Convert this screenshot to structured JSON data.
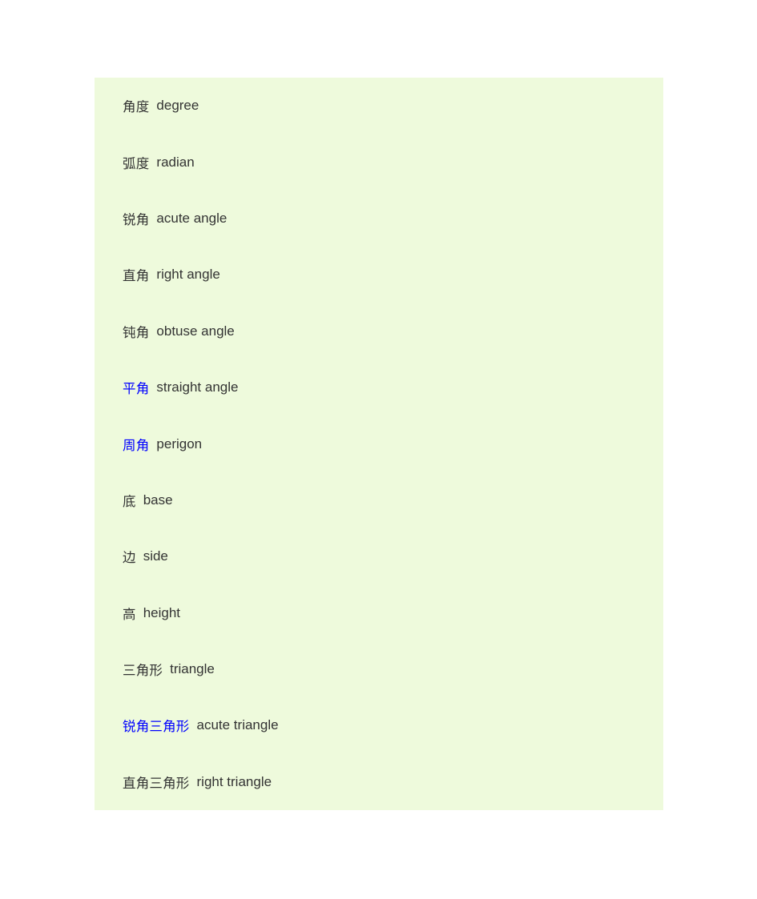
{
  "page": {
    "background_color": "#ffffff",
    "panel_background_color": "#eefadc",
    "text_color": "#333333",
    "link_color": "#0000ff"
  },
  "glossary": {
    "entries": [
      {
        "cn": "角度",
        "en": "degree",
        "is_link": false
      },
      {
        "cn": "弧度",
        "en": "radian",
        "is_link": false
      },
      {
        "cn": "锐角",
        "en": "acute angle",
        "is_link": false
      },
      {
        "cn": "直角",
        "en": "right angle",
        "is_link": false
      },
      {
        "cn": "钝角",
        "en": "obtuse angle",
        "is_link": false
      },
      {
        "cn": "平角",
        "en": "straight angle",
        "is_link": true
      },
      {
        "cn": "周角",
        "en": "perigon",
        "is_link": true
      },
      {
        "cn": "底",
        "en": "base",
        "is_link": false
      },
      {
        "cn": "边",
        "en": "side",
        "is_link": false
      },
      {
        "cn": "高",
        "en": "height",
        "is_link": false
      },
      {
        "cn": "三角形",
        "en": "triangle",
        "is_link": false
      },
      {
        "cn": "锐角三角形",
        "en": "acute triangle",
        "is_link": true
      },
      {
        "cn": "直角三角形",
        "en": "right triangle",
        "is_link": false
      }
    ]
  }
}
